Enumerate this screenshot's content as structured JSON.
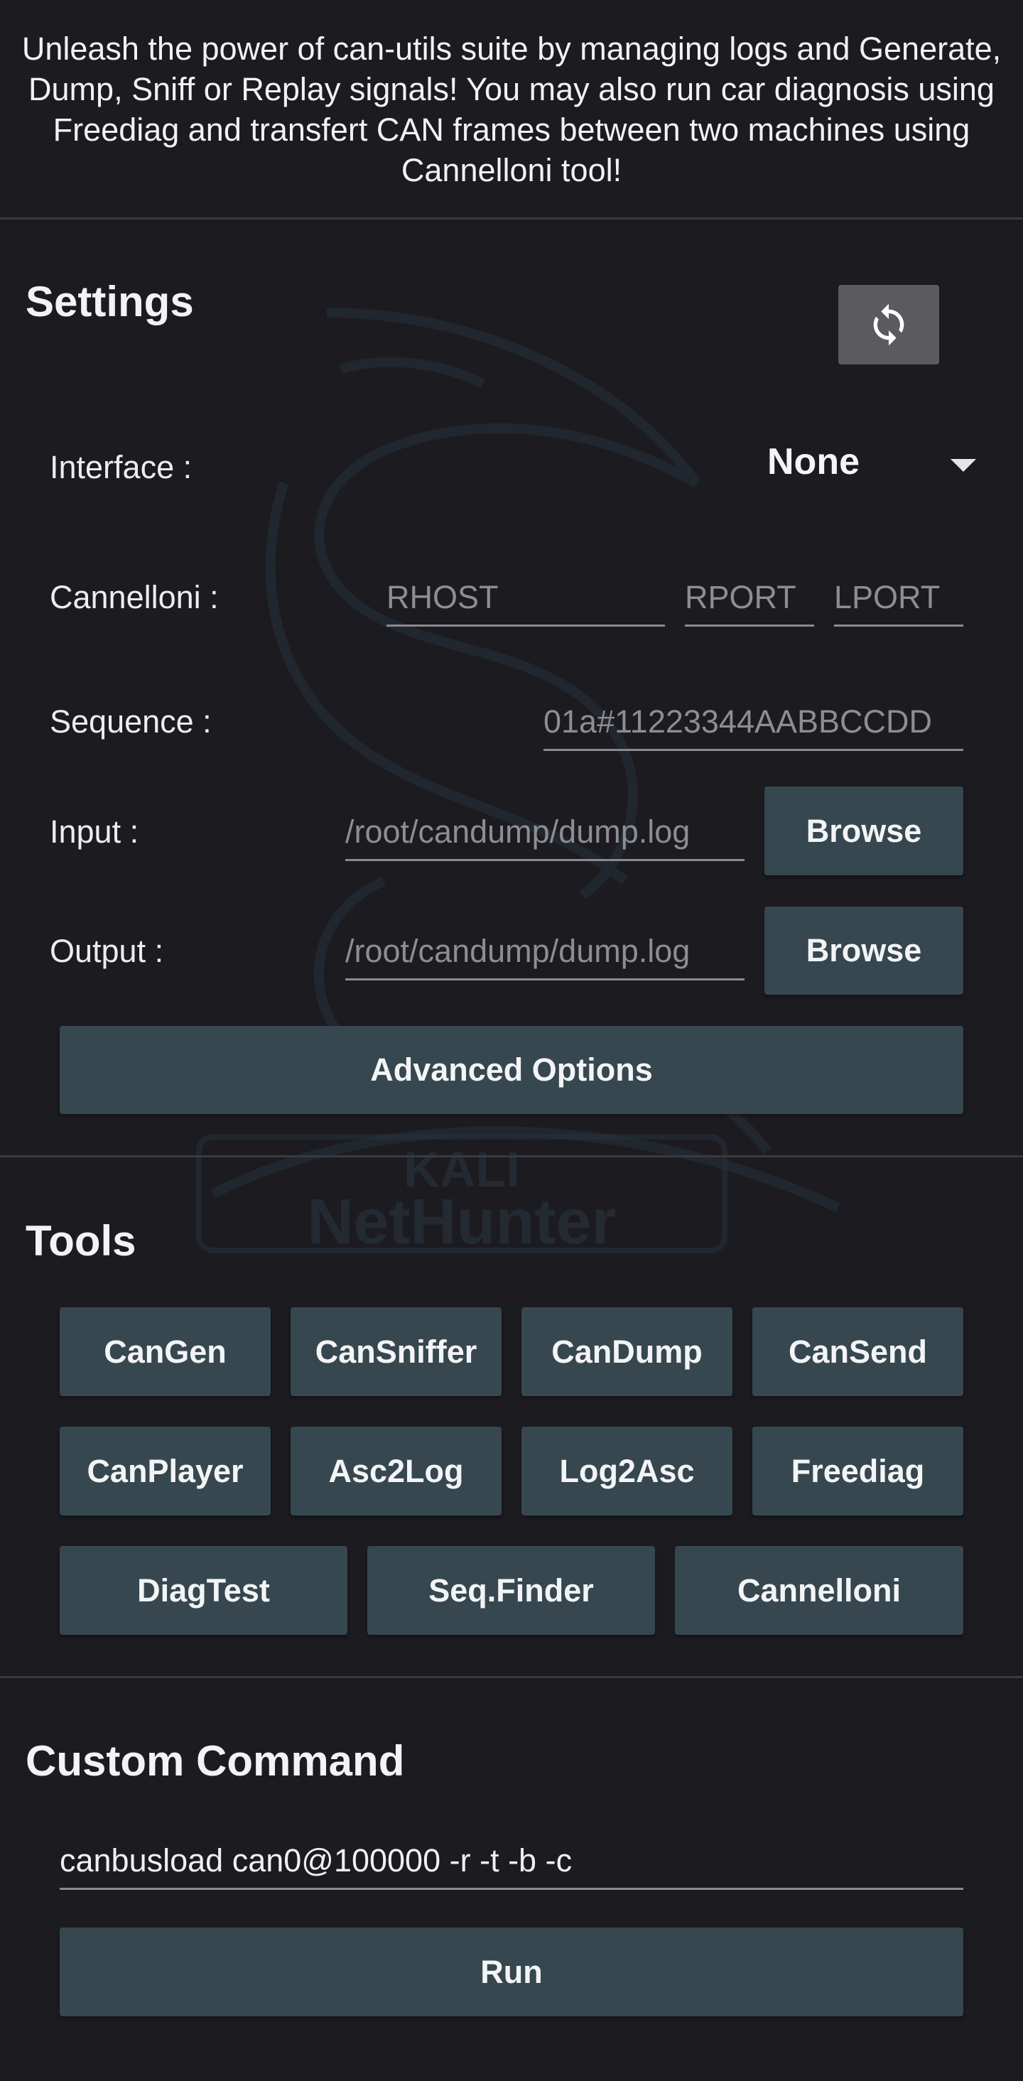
{
  "intro": "Unleash the power of can-utils suite by managing logs and Generate, Dump, Sniff or Replay signals! You may also run car diagnosis using Freediag and transfert CAN frames between two machines using Cannelloni tool!",
  "watermark": {
    "line1": "KALI",
    "line2": "NetHunter"
  },
  "settings": {
    "title": "Settings",
    "interface_label": "Interface :",
    "interface_value": "None",
    "cannelloni_label": "Cannelloni :",
    "rhost_placeholder": "RHOST",
    "rport_placeholder": "RPORT",
    "lport_placeholder": "LPORT",
    "sequence_label": "Sequence :",
    "sequence_placeholder": "01a#11223344AABBCCDD",
    "input_label": "Input :",
    "input_placeholder": "/root/candump/dump.log",
    "output_label": "Output :",
    "output_placeholder": "/root/candump/dump.log",
    "browse_label": "Browse",
    "advanced_label": "Advanced Options"
  },
  "tools": {
    "title": "Tools",
    "row1": [
      "CanGen",
      "CanSniffer",
      "CanDump",
      "CanSend"
    ],
    "row2": [
      "CanPlayer",
      "Asc2Log",
      "Log2Asc",
      "Freediag"
    ],
    "row3": [
      "DiagTest",
      "Seq.Finder",
      "Cannelloni"
    ]
  },
  "custom": {
    "title": "Custom Command",
    "command": "canbusload can0@100000 -r -t -b -c",
    "run_label": "Run"
  },
  "colors": {
    "background": "#1c1b20",
    "button": "#37474f",
    "refresh_button": "#5b5b5f",
    "divider": "#3a3a40"
  },
  "icons": {
    "refresh": "refresh-icon",
    "dropdown": "dropdown-arrow-icon"
  }
}
